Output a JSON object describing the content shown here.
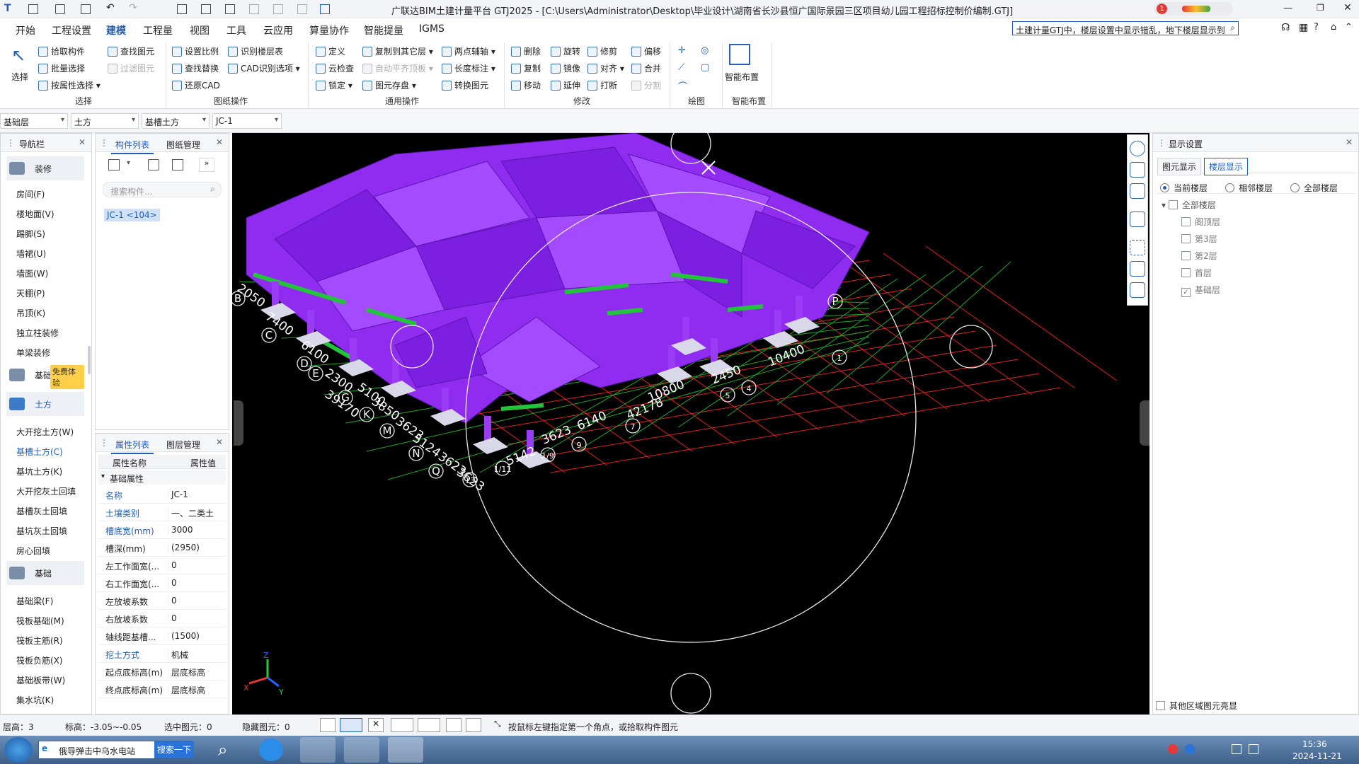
{
  "app": {
    "title": "广联达BIM土建计量平台 GTJ2025 - [C:\\Users\\Administrator\\Desktop\\毕业设计\\湖南省长沙县恒广国际景园三区项目幼儿园工程招标控制价编制.GTJ]",
    "notification_count": "1",
    "search_value": "土建计量GTJ中，楼层设置中显示错乱，地下楼层显示到"
  },
  "menu": [
    "开始",
    "工程设置",
    "建模",
    "工程量",
    "视图",
    "工具",
    "云应用",
    "算量协作",
    "智能提量",
    "IGMS"
  ],
  "menu_active": "建模",
  "ribbon": {
    "select_label": "选择",
    "select_group": [
      {
        "label": "拾取构件",
        "icon": "pick-icon",
        "disabled": false
      },
      {
        "label": "批量选择",
        "icon": "batch-select-icon",
        "disabled": false
      },
      {
        "label": "按属性选择",
        "icon": "attr-select-icon",
        "disabled": false
      }
    ],
    "select_group_b": [
      {
        "label": "查找图元",
        "icon": "find-icon",
        "disabled": false
      },
      {
        "label": "过滤图元",
        "icon": "filter-icon",
        "disabled": true
      }
    ],
    "select_group_title": "选择",
    "drawing_group": [
      {
        "label": "设置比例",
        "icon": "scale-icon",
        "disabled": false
      },
      {
        "label": "查找替换",
        "icon": "replace-icon",
        "disabled": false
      },
      {
        "label": "还原CAD",
        "icon": "cad-icon",
        "disabled": false
      }
    ],
    "drawing_group_b": [
      {
        "label": "识别楼层表",
        "icon": "floor-table-icon",
        "disabled": false
      },
      {
        "label": "CAD识别选项",
        "icon": "cad-option-icon",
        "disabled": false
      }
    ],
    "drawing_group_title": "图纸操作",
    "common_group": [
      {
        "label": "定义",
        "icon": "define-icon",
        "disabled": false
      },
      {
        "label": "云检查",
        "icon": "cloud-check-icon",
        "disabled": false
      },
      {
        "label": "锁定",
        "icon": "lock-icon",
        "disabled": false
      }
    ],
    "common_group_b": [
      {
        "label": "复制到其它层",
        "icon": "copy-layer-icon",
        "disabled": false
      },
      {
        "label": "自动平齐顶板",
        "icon": "align-top-icon",
        "disabled": true
      },
      {
        "label": "图元存盘",
        "icon": "save-element-icon",
        "disabled": false
      }
    ],
    "common_group_c": [
      {
        "label": "两点辅轴",
        "icon": "aux-axis-icon",
        "disabled": false
      },
      {
        "label": "长度标注",
        "icon": "dimension-icon",
        "disabled": false
      },
      {
        "label": "转换图元",
        "icon": "convert-icon",
        "disabled": false
      }
    ],
    "common_group_title": "通用操作",
    "modify_group": [
      {
        "label": "删除",
        "icon": "delete-icon",
        "disabled": false
      },
      {
        "label": "复制",
        "icon": "copy-icon",
        "disabled": false
      },
      {
        "label": "移动",
        "icon": "move-icon",
        "disabled": false
      }
    ],
    "modify_group_b": [
      {
        "label": "旋转",
        "icon": "rotate-icon",
        "disabled": false
      },
      {
        "label": "镜像",
        "icon": "mirror-icon",
        "disabled": false
      },
      {
        "label": "延伸",
        "icon": "extend-icon",
        "disabled": false
      }
    ],
    "modify_group_c": [
      {
        "label": "修剪",
        "icon": "trim-icon",
        "disabled": false
      },
      {
        "label": "对齐",
        "icon": "align-icon",
        "disabled": false
      },
      {
        "label": "打断",
        "icon": "break-icon",
        "disabled": false
      }
    ],
    "modify_group_d": [
      {
        "label": "偏移",
        "icon": "offset-icon",
        "disabled": false
      },
      {
        "label": "合并",
        "icon": "merge-icon",
        "disabled": false
      },
      {
        "label": "分割",
        "icon": "split-icon",
        "disabled": true
      }
    ],
    "modify_group_title": "修改",
    "draw_group_title": "绘图",
    "smart_label": "智能布置",
    "smart_group_title": "智能布置"
  },
  "selectors": [
    "基础层",
    "土方",
    "基槽土方",
    "JC-1"
  ],
  "nav": {
    "title": "导航栏",
    "sections": [
      {
        "label": "装修",
        "items": [
          "房间(F)",
          "楼地面(V)",
          "踢脚(S)",
          "墙裙(U)",
          "墙面(W)",
          "天棚(P)",
          "吊顶(K)",
          "独立柱装修",
          "单梁装修"
        ]
      },
      {
        "label": "基础",
        "badge": "免费体验"
      },
      {
        "label": "土方",
        "items": [
          "大开挖土方(W)",
          "基槽土方(C)",
          "基坑土方(K)",
          "大开挖灰土回填",
          "基槽灰土回填",
          "基坑灰土回填",
          "房心回填"
        ]
      },
      {
        "label": "基础",
        "items": [
          "基础梁(F)",
          "筏板基础(M)",
          "筏板主筋(R)",
          "筏板负筋(X)",
          "基础板带(W)",
          "集水坑(K)"
        ]
      }
    ],
    "active_item": "基槽土方(C)"
  },
  "component_list": {
    "tabs": [
      "构件列表",
      "图纸管理"
    ],
    "search_placeholder": "搜索构件...",
    "items": [
      "JC-1 <104>"
    ]
  },
  "properties": {
    "tabs": [
      "属性列表",
      "图层管理"
    ],
    "headers": [
      "属性名称",
      "属性值"
    ],
    "group": "基础属性",
    "rows": [
      {
        "name": "名称",
        "value": "JC-1",
        "link": true
      },
      {
        "name": "土壤类别",
        "value": "一、二类土",
        "link": true
      },
      {
        "name": "槽底宽(mm)",
        "value": "3000",
        "link": true
      },
      {
        "name": "槽深(mm)",
        "value": "(2950)",
        "link": false
      },
      {
        "name": "左工作面宽(...",
        "value": "0",
        "link": false
      },
      {
        "name": "右工作面宽(...",
        "value": "0",
        "link": false
      },
      {
        "name": "左放坡系数",
        "value": "0",
        "link": false
      },
      {
        "name": "右放坡系数",
        "value": "0",
        "link": false
      },
      {
        "name": "轴线距基槽...",
        "value": "(1500)",
        "link": false
      },
      {
        "name": "挖土方式",
        "value": "机械",
        "link": true
      },
      {
        "name": "起点底标高(m)",
        "value": "层底标高",
        "link": false
      },
      {
        "name": "终点底标高(m)",
        "value": "层底标高",
        "link": false
      }
    ]
  },
  "viewport": {
    "grid_labels_left": [
      "2050",
      "7400",
      "6100",
      "2300",
      "39170",
      "5100",
      "3850",
      "3623",
      "5124",
      "3623",
      "3623"
    ],
    "grid_labels_bottom": [
      "5142",
      "3623",
      "6140",
      "42178",
      "10800",
      "2450",
      "10400"
    ],
    "axis_letters": [
      "B",
      "C",
      "D",
      "E",
      "G",
      "K",
      "M",
      "N",
      "Q",
      "P"
    ],
    "axis_numbers": [
      "13",
      "1/11",
      "1/9",
      "9",
      "7",
      "5",
      "4",
      "1"
    ],
    "fraction_labels": [
      "1/11",
      "1/9"
    ],
    "colors": {
      "structure": "#8f2cf0",
      "green": "#22c43a",
      "grid": "#e02020",
      "axis": "#1aa82a"
    }
  },
  "display_settings": {
    "title": "显示设置",
    "tabs": [
      "图元显示",
      "楼层显示"
    ],
    "radios": [
      "当前楼层",
      "相邻楼层",
      "全部楼层"
    ],
    "tree_root": "全部楼层",
    "floors": [
      {
        "label": "阁顶层",
        "checked": false
      },
      {
        "label": "第3层",
        "checked": false
      },
      {
        "label": "第2层",
        "checked": false
      },
      {
        "label": "首层",
        "checked": false
      },
      {
        "label": "基础层",
        "checked": true
      }
    ],
    "footer": "其他区域图元亮显"
  },
  "status": {
    "floor_height": "层高：3",
    "elevation": "标高：-3.05~-0.05",
    "selected": "选中图元：0",
    "hidden": "隐藏图元：0",
    "hint": "按鼠标左键指定第一个角点，或拾取构件图元"
  },
  "taskbar": {
    "search_text": "俄导弹击中乌水电站",
    "search_btn": "搜索一下",
    "time": "15:36",
    "date": "2024-11-21"
  }
}
